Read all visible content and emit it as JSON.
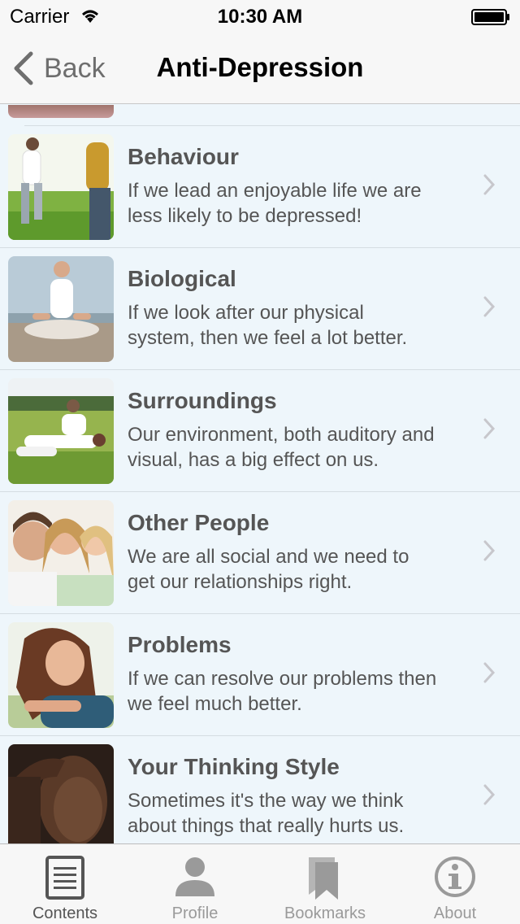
{
  "status_bar": {
    "carrier": "Carrier",
    "time": "10:30 AM"
  },
  "nav": {
    "back_label": "Back",
    "title": "Anti-Depression"
  },
  "list": {
    "items": [
      {
        "title": "Behaviour",
        "line1": "If we lead an enjoyable life we are",
        "line2": "less likely to be depressed!"
      },
      {
        "title": "Biological",
        "line1": "If we look after our physical",
        "line2": "system, then we feel a lot better."
      },
      {
        "title": "Surroundings",
        "line1": "Our environment, both auditory and",
        "line2": "visual, has a big effect on us."
      },
      {
        "title": "Other People",
        "line1": "We are all social and we need to",
        "line2": "get our relationships right."
      },
      {
        "title": "Problems",
        "line1": "If we can resolve our problems then",
        "line2": "we feel much better."
      },
      {
        "title": "Your Thinking Style",
        "line1": "Sometimes it's the way we think",
        "line2": "about things that really hurts us."
      }
    ]
  },
  "tab_bar": {
    "tabs": [
      {
        "label": "Contents",
        "icon": "document-icon",
        "active": true
      },
      {
        "label": "Profile",
        "icon": "person-icon",
        "active": false
      },
      {
        "label": "Bookmarks",
        "icon": "bookmark-icon",
        "active": false
      },
      {
        "label": "About",
        "icon": "info-icon",
        "active": false
      }
    ]
  },
  "colors": {
    "background": "#eef6fb",
    "bar": "#f7f7f7",
    "text": "#555555",
    "tab_active": "#555555",
    "tab_inactive": "#9a9a9a"
  }
}
